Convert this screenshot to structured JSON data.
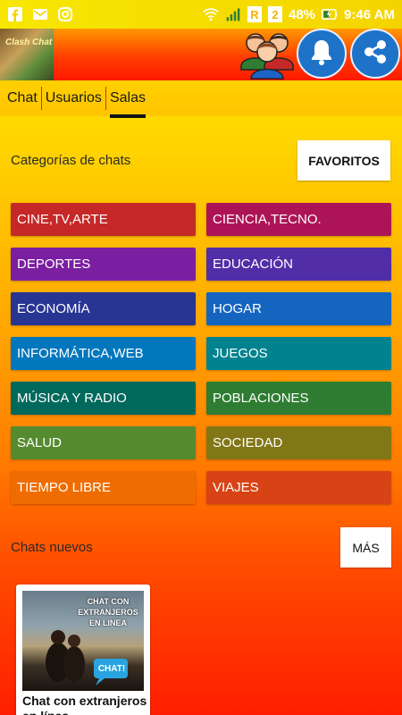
{
  "status_bar": {
    "battery": "48%",
    "time": "9:46 AM",
    "sim1": "R",
    "sim2": "2",
    "left_icons": [
      "facebook-icon",
      "mail-icon",
      "instagram-icon"
    ]
  },
  "header": {
    "logo_text": "Clash Chat"
  },
  "tabs": [
    {
      "label": "Chat"
    },
    {
      "label": "Usuarios"
    },
    {
      "label": "Salas"
    }
  ],
  "categories_section": {
    "title": "Categorías de chats",
    "button": "FAVORITOS",
    "items": [
      {
        "label": "CINE,TV,ARTE",
        "color": "#c62828"
      },
      {
        "label": "CIENCIA,TECNO.",
        "color": "#ad1457"
      },
      {
        "label": "DEPORTES",
        "color": "#7b1fa2"
      },
      {
        "label": "EDUCACIÓN",
        "color": "#512da8"
      },
      {
        "label": "ECONOMÍA",
        "color": "#283593"
      },
      {
        "label": "HOGAR",
        "color": "#1565c0"
      },
      {
        "label": "INFORMÁTICA,WEB",
        "color": "#0277bd"
      },
      {
        "label": "JUEGOS",
        "color": "#00838f"
      },
      {
        "label": "MÚSICA Y RADIO",
        "color": "#00695c"
      },
      {
        "label": "POBLACIONES",
        "color": "#2e7d32"
      },
      {
        "label": "SALUD",
        "color": "#558b2f"
      },
      {
        "label": "SOCIEDAD",
        "color": "#827717"
      },
      {
        "label": "TIEMPO LIBRE",
        "color": "#ef6c00"
      },
      {
        "label": "VIAJES",
        "color": "#d84315"
      }
    ]
  },
  "new_chats_section": {
    "title": "Chats nuevos",
    "button": "MÁS",
    "cards": [
      {
        "title": "Chat con extranjeros en línea",
        "image_text": "CHAT CON EXTRANJEROS EN LINEA",
        "badge": "CHAT!"
      }
    ]
  }
}
